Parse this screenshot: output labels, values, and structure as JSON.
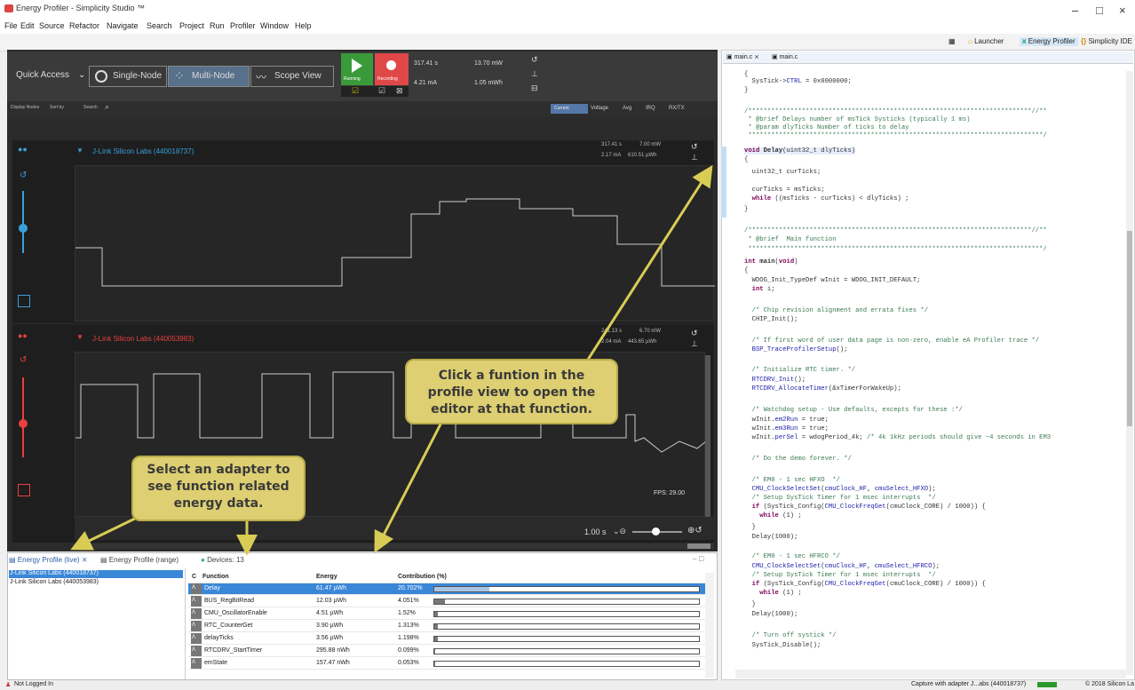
{
  "app": {
    "title": "Energy Profiler - Simplicity Studio ™"
  },
  "menu": [
    "File",
    "Edit",
    "Source",
    "Refactor",
    "Navigate",
    "Search",
    "Project",
    "Run",
    "Profiler",
    "Window",
    "Help"
  ],
  "perspectives": [
    "Launcher",
    "Energy Profiler",
    "Simplicity IDE"
  ],
  "profiler": {
    "quick_access": "Quick Access",
    "modes": [
      "Single-Node",
      "Multi-Node",
      "Scope View"
    ],
    "running": "Running",
    "recording": "Recording",
    "stats": {
      "time": "317.41 s",
      "power": "13.70 mW",
      "current": "4.21 mA",
      "energy": "1.05 mWh"
    },
    "filter": {
      "display_nodes": "Display Nodes",
      "sort_by": "Sort by",
      "search": "Search"
    },
    "measures": [
      "Current",
      "Voltage",
      "Avg",
      "IRQ",
      "RX/TX"
    ],
    "nodes": [
      {
        "name": "J-Link Silicon Labs (440018737)",
        "time": "317.41 s",
        "power": "7.00 mW",
        "current": "2.17 mA",
        "energy": "610.51 µWh",
        "color": "#3aa0dd"
      },
      {
        "name": "J-Link Silicon Labs (440053983)",
        "time": "241.13 s",
        "power": "6.70 mW",
        "current": "2.04 mA",
        "energy": "443.65 µWh",
        "color": "#e84040"
      }
    ],
    "fps": "FPS: 29.00",
    "zoom": "1.00 s"
  },
  "callouts": {
    "function": "Click a funtion in the profile view to open the editor at that function.",
    "adapter": "Select an adapter to see function related energy data."
  },
  "energy_panel": {
    "tabs": [
      "Energy Profile (live)",
      "Energy Profile (range)",
      "Devices: 13"
    ],
    "adapters": [
      "J-Link Silicon Labs (440018737)",
      "J-Link Silicon Labs (440053983)"
    ],
    "columns": [
      "C",
      "Function",
      "Energy",
      "Contribution (%)"
    ],
    "rows": [
      {
        "fn": "Delay",
        "energy": "61.47 µWh",
        "pct": "20.702%",
        "frac": 0.207
      },
      {
        "fn": "BUS_RegBitRead",
        "energy": "12.03 µWh",
        "pct": "4.051%",
        "frac": 0.041
      },
      {
        "fn": "CMU_OscillatorEnable",
        "energy": "4.51 µWh",
        "pct": "1.52%",
        "frac": 0.015
      },
      {
        "fn": "RTC_CounterGet",
        "energy": "3.90 µWh",
        "pct": "1.313%",
        "frac": 0.013
      },
      {
        "fn": "delayTicks",
        "energy": "3.56 µWh",
        "pct": "1.198%",
        "frac": 0.012
      },
      {
        "fn": "RTCDRV_StartTimer",
        "energy": "295.88 nWh",
        "pct": "0.099%",
        "frac": 0.001
      },
      {
        "fn": "emState",
        "energy": "157.47 nWh",
        "pct": "0.053%",
        "frac": 0.0005
      }
    ]
  },
  "editor": {
    "tabs": [
      "main.c",
      "main.c"
    ]
  },
  "status": {
    "left": "Not Logged In",
    "right": "Capture with adapter J...abs (440018737)",
    "copyright": "© 2018 Silicon La"
  }
}
